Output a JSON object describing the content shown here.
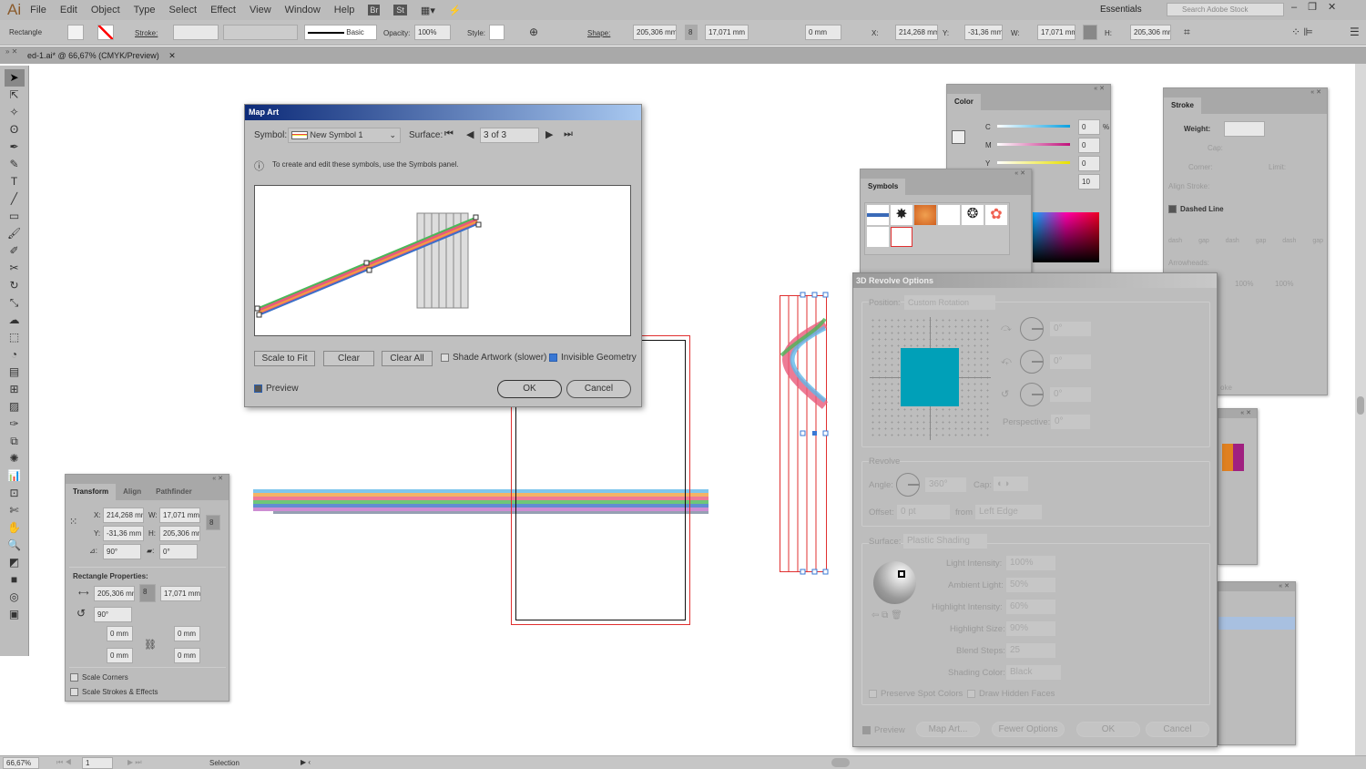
{
  "app": {
    "logo": "Ai",
    "menu": [
      "File",
      "Edit",
      "Object",
      "Type",
      "Select",
      "Effect",
      "View",
      "Window",
      "Help"
    ],
    "bridge": "Br",
    "stock": "St",
    "workspace": "Essentials",
    "search_placeholder": "Search Adobe Stock"
  },
  "control": {
    "object_type": "Rectangle",
    "stroke_label": "Stroke:",
    "brush": "Basic",
    "opacity_label": "Opacity:",
    "opacity": "100%",
    "style_label": "Style:",
    "shape_label": "Shape:",
    "shape_w": "205,306 mm",
    "shape_h": "17,071 mm",
    "corner": "0 mm",
    "x_label": "X:",
    "x": "214,268 mm",
    "y_label": "Y:",
    "y": "-31,36 mm",
    "w_label": "W:",
    "w": "17,071 mm",
    "h_label": "H:",
    "h": "205,306 mm"
  },
  "document": {
    "tab": "ed-1.ai* @ 66,67% (CMYK/Preview)"
  },
  "status": {
    "zoom": "66,67%",
    "artboard": "1",
    "tool": "Selection"
  },
  "transform": {
    "tabs": [
      "Transform",
      "Align",
      "Pathfinder"
    ],
    "x": "214,268 mm",
    "y": "-31,36 mm",
    "w": "17,071 mm",
    "h": "205,306 mm",
    "angle": "90°",
    "shear": "0°",
    "rect_props": "Rectangle Properties:",
    "rw": "205,306 mm",
    "rh": "17,071 mm",
    "rot": "90°",
    "r1": "0 mm",
    "r2": "0 mm",
    "r3": "0 mm",
    "r4": "0 mm",
    "scale_corners": "Scale Corners",
    "scale_strokes": "Scale Strokes & Effects",
    "labels": {
      "x": "X:",
      "y": "Y:",
      "w": "W:",
      "h": "H:"
    }
  },
  "map_art": {
    "title": "Map Art",
    "symbol_label": "Symbol:",
    "symbol": "New Symbol 1",
    "surface_label": "Surface:",
    "surface": "3 of 3",
    "info": "To create and edit these symbols, use the Symbols panel.",
    "scale_to_fit": "Scale to Fit",
    "clear": "Clear",
    "clear_all": "Clear All",
    "shade": "Shade Artwork (slower)",
    "shade_checked": false,
    "invisible": "Invisible Geometry",
    "invisible_checked": true,
    "preview": "Preview",
    "preview_checked": true,
    "ok": "OK",
    "cancel": "Cancel"
  },
  "revolve": {
    "title": "3D Revolve Options",
    "position_label": "Position:",
    "position": "Custom Rotation",
    "rot_x": "0°",
    "rot_y": "0°",
    "rot_z": "0°",
    "perspective_label": "Perspective:",
    "perspective": "0°",
    "revolve_label": "Revolve",
    "angle_label": "Angle:",
    "angle": "360°",
    "cap_label": "Cap:",
    "offset_label": "Offset:",
    "offset": "0 pt",
    "from_label": "from",
    "from": "Left Edge",
    "surface_label": "Surface:",
    "surface": "Plastic Shading",
    "light_intensity_label": "Light Intensity:",
    "light_intensity": "100%",
    "ambient_label": "Ambient Light:",
    "ambient": "50%",
    "highlight_int_label": "Highlight Intensity:",
    "highlight_int": "60%",
    "highlight_size_label": "Highlight Size:",
    "highlight_size": "90%",
    "blend_label": "Blend Steps:",
    "blend": "25",
    "shading_color_label": "Shading Color:",
    "shading_color": "Black",
    "preserve": "Preserve Spot Colors",
    "hidden": "Draw Hidden Faces",
    "preview": "Preview",
    "map_art": "Map Art...",
    "fewer": "Fewer Options",
    "ok": "OK",
    "cancel": "Cancel",
    "object_color": "#00a0b8"
  },
  "color_panel": {
    "title": "Color",
    "c": "0",
    "m": "0",
    "y": "0",
    "k": "10",
    "labels": [
      "C",
      "M",
      "Y"
    ],
    "pct": "%"
  },
  "symbols_panel": {
    "title": "Symbols"
  },
  "stroke_panel": {
    "title": "Stroke",
    "weight": "Weight:",
    "cap": "Cap:",
    "corner": "Corner:",
    "limit": "Limit:",
    "align": "Align Stroke:",
    "dashed": "Dashed Line",
    "dash_labels": [
      "dash",
      "gap",
      "dash",
      "gap",
      "dash",
      "gap"
    ],
    "arrowheads": "Arrowheads:",
    "scale1": "100%",
    "scale2": "100%",
    "stroke_partial": "oke"
  }
}
